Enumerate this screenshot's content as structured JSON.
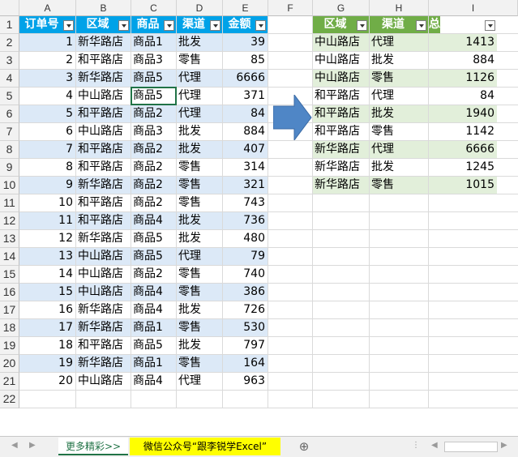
{
  "columns": [
    "A",
    "B",
    "C",
    "D",
    "E",
    "F",
    "G",
    "H",
    "I"
  ],
  "rows": [
    "1",
    "2",
    "3",
    "4",
    "5",
    "6",
    "7",
    "8",
    "9",
    "10",
    "11",
    "12",
    "13",
    "14",
    "15",
    "16",
    "17",
    "18",
    "19",
    "20",
    "21",
    "22"
  ],
  "left_table": {
    "headers": [
      "订单号",
      "区域",
      "商品",
      "渠道",
      "金额"
    ],
    "rows": [
      [
        "1",
        "新华路店",
        "商品1",
        "批发",
        "39"
      ],
      [
        "2",
        "和平路店",
        "商品3",
        "零售",
        "85"
      ],
      [
        "3",
        "新华路店",
        "商品5",
        "代理",
        "6666"
      ],
      [
        "4",
        "中山路店",
        "商品5",
        "代理",
        "371"
      ],
      [
        "5",
        "和平路店",
        "商品2",
        "代理",
        "84"
      ],
      [
        "6",
        "中山路店",
        "商品3",
        "批发",
        "884"
      ],
      [
        "7",
        "和平路店",
        "商品2",
        "批发",
        "407"
      ],
      [
        "8",
        "和平路店",
        "商品2",
        "零售",
        "314"
      ],
      [
        "9",
        "新华路店",
        "商品2",
        "零售",
        "321"
      ],
      [
        "10",
        "和平路店",
        "商品2",
        "零售",
        "743"
      ],
      [
        "11",
        "和平路店",
        "商品4",
        "批发",
        "736"
      ],
      [
        "12",
        "新华路店",
        "商品5",
        "批发",
        "480"
      ],
      [
        "13",
        "中山路店",
        "商品5",
        "代理",
        "79"
      ],
      [
        "14",
        "中山路店",
        "商品2",
        "零售",
        "740"
      ],
      [
        "15",
        "中山路店",
        "商品4",
        "零售",
        "386"
      ],
      [
        "16",
        "新华路店",
        "商品4",
        "批发",
        "726"
      ],
      [
        "17",
        "新华路店",
        "商品1",
        "零售",
        "530"
      ],
      [
        "18",
        "和平路店",
        "商品5",
        "批发",
        "797"
      ],
      [
        "19",
        "新华路店",
        "商品1",
        "零售",
        "164"
      ],
      [
        "20",
        "中山路店",
        "商品4",
        "代理",
        "963"
      ]
    ]
  },
  "right_table": {
    "headers": [
      "区域",
      "渠道",
      "总金额"
    ],
    "rows": [
      [
        "中山路店",
        "代理",
        "1413"
      ],
      [
        "中山路店",
        "批发",
        "884"
      ],
      [
        "中山路店",
        "零售",
        "1126"
      ],
      [
        "和平路店",
        "代理",
        "84"
      ],
      [
        "和平路店",
        "批发",
        "1940"
      ],
      [
        "和平路店",
        "零售",
        "1142"
      ],
      [
        "新华路店",
        "代理",
        "6666"
      ],
      [
        "新华路店",
        "批发",
        "1245"
      ],
      [
        "新华路店",
        "零售",
        "1015"
      ]
    ]
  },
  "tabs": {
    "more": "更多精彩>>",
    "wechat": "微信公众号“跟李锐学Excel”",
    "add": "⊕"
  },
  "colors": {
    "table1_header": "#00a2e8",
    "table1_band": "#dce9f7",
    "table2_header": "#70ad47",
    "table2_band": "#e2efda",
    "arrow": "#4f86c6",
    "tab_highlight": "#ffff00"
  }
}
